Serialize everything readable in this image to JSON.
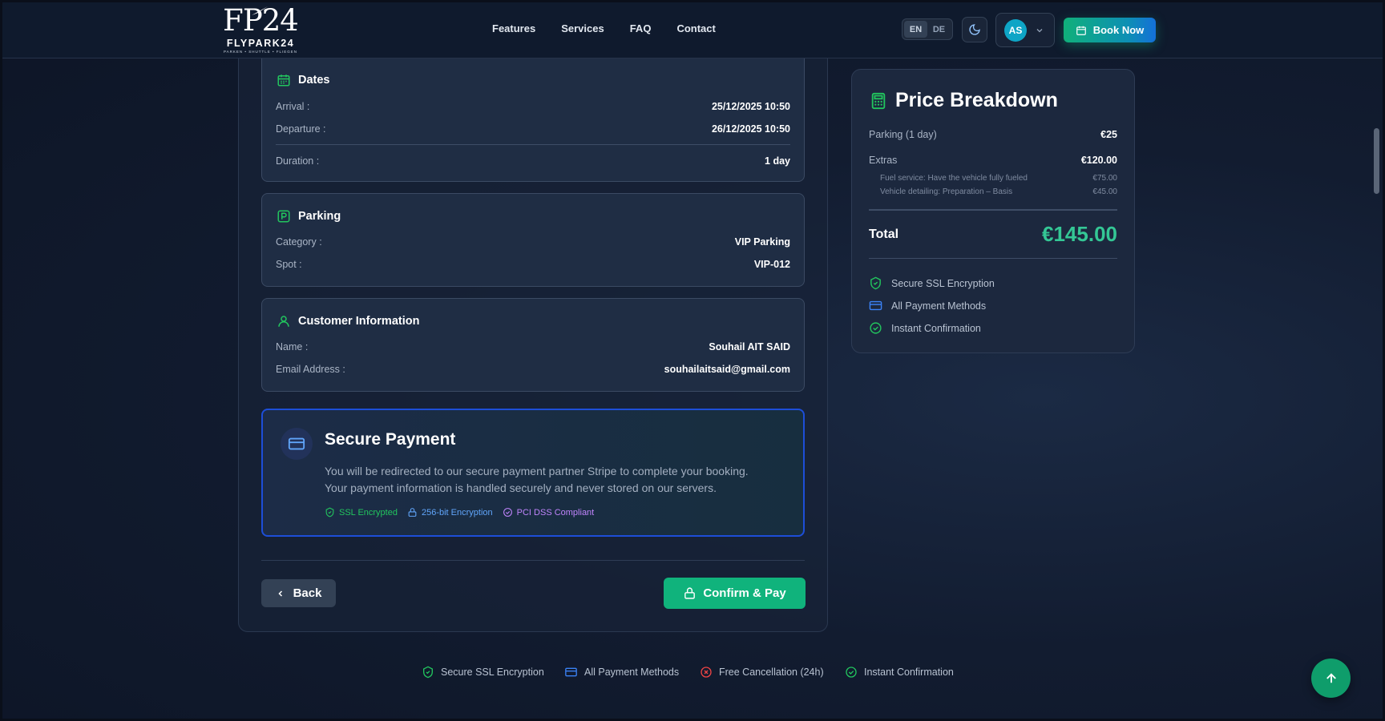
{
  "header": {
    "logo": {
      "mark": "FP24",
      "name": "FLYPARK24",
      "tagline": "PARKEN • SHUTTLE • FLIEGEN"
    },
    "nav": [
      "Features",
      "Services",
      "FAQ",
      "Contact"
    ],
    "lang": {
      "en": "EN",
      "de": "DE",
      "active": "EN"
    },
    "theme_icon": "moon-icon",
    "user_initials": "AS",
    "book_label": "Book Now"
  },
  "dates": {
    "title": "Dates",
    "arrival_label": "Arrival :",
    "arrival_value": "25/12/2025 10:50",
    "departure_label": "Departure :",
    "departure_value": "26/12/2025 10:50",
    "duration_label": "Duration :",
    "duration_value": "1 day"
  },
  "parking": {
    "title": "Parking",
    "category_label": "Category :",
    "category_value": "VIP Parking",
    "spot_label": "Spot :",
    "spot_value": "VIP-012"
  },
  "customer": {
    "title": "Customer Information",
    "name_label": "Name :",
    "name_value": "Souhail AIT SAID",
    "email_label": "Email Address :",
    "email_value": "souhailaitsaid@gmail.com"
  },
  "payment": {
    "title": "Secure Payment",
    "text": "You will be redirected to our secure payment partner Stripe to complete your booking. Your payment information is handled securely and never stored on our servers.",
    "badges": [
      {
        "label": "SSL Encrypted",
        "icon": "shield-check-icon",
        "color": "#22c55e"
      },
      {
        "label": "256-bit Encryption",
        "icon": "lock-icon",
        "color": "#60a5fa"
      },
      {
        "label": "PCI DSS Compliant",
        "icon": "check-circle-icon",
        "color": "#c084fc"
      }
    ]
  },
  "actions": {
    "back_label": "Back",
    "confirm_label": "Confirm & Pay"
  },
  "price": {
    "title": "Price Breakdown",
    "parking_label": "Parking (1 day)",
    "parking_value": "€25",
    "extras_label": "Extras",
    "extras_value": "€120.00",
    "extras_items": [
      {
        "label": "Fuel service: Have the vehicle fully fueled",
        "value": "€75.00"
      },
      {
        "label": "Vehicle detailing: Preparation – Basis",
        "value": "€45.00"
      }
    ],
    "total_label": "Total",
    "total_value": "€145.00",
    "features": [
      {
        "label": "Secure SSL Encryption",
        "icon": "shield-check-icon",
        "color": "#22c55e"
      },
      {
        "label": "All Payment Methods",
        "icon": "credit-card-icon",
        "color": "#3b82f6"
      },
      {
        "label": "Instant Confirmation",
        "icon": "check-circle-icon",
        "color": "#22c55e"
      }
    ]
  },
  "footer": {
    "features": [
      {
        "label": "Secure SSL Encryption",
        "icon": "shield-check-icon",
        "color": "#22c55e"
      },
      {
        "label": "All Payment Methods",
        "icon": "credit-card-icon",
        "color": "#3b82f6"
      },
      {
        "label": "Free Cancellation (24h)",
        "icon": "x-circle-icon",
        "color": "#ef4444"
      },
      {
        "label": "Instant Confirmation",
        "icon": "check-circle-icon",
        "color": "#22c55e"
      }
    ]
  },
  "colors": {
    "accent": "#10b37c",
    "brand_blue": "#1470d8",
    "bg": "#121c30"
  }
}
